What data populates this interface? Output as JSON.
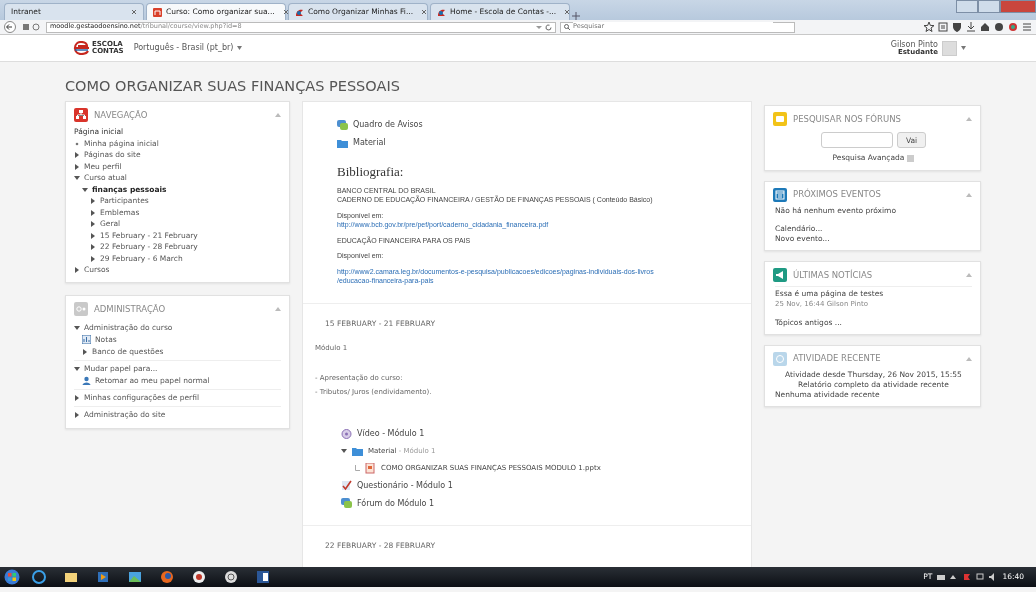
{
  "browser": {
    "tabs": [
      {
        "label": "Intranet",
        "selected": false,
        "kind": "plain"
      },
      {
        "label": "Curso: Como organizar sua...",
        "selected": true,
        "kind": "moodle"
      },
      {
        "label": "Como Organizar Minhas Fi...",
        "selected": false,
        "kind": "site"
      },
      {
        "label": "Home - Escola de Contas -...",
        "selected": false,
        "kind": "site"
      }
    ],
    "url_host": "moodle.gestaodoensino.net",
    "url_path": "/tribunal/course/view.php?id=8",
    "search_placeholder": "Pesquisar"
  },
  "header": {
    "logo_lines": [
      "ESCOLA",
      "CONTAS"
    ],
    "language": "Português - Brasil (pt_br)",
    "user_name": "Gilson Pinto",
    "user_role": "Estudante"
  },
  "course_title": "COMO ORGANIZAR SUAS FINANÇAS PESSOAIS",
  "left_blocks": [
    {
      "kind": "navigation",
      "title": "NAVEGAÇÃO",
      "tree": [
        {
          "label": "Página inicial",
          "kind": "link",
          "children": [
            {
              "label": "Minha página inicial",
              "kind": "leaf"
            },
            {
              "label": "Páginas do site",
              "kind": "branch",
              "expanded": false
            },
            {
              "label": "Meu perfil",
              "kind": "branch",
              "expanded": false
            },
            {
              "label": "Curso atual",
              "kind": "branch",
              "expanded": true,
              "children": [
                {
                  "label": "finanças pessoais",
                  "kind": "course",
                  "expanded": true,
                  "children": [
                    {
                      "label": "Participantes",
                      "kind": "branch",
                      "expanded": false
                    },
                    {
                      "label": "Emblemas",
                      "kind": "branch",
                      "expanded": false
                    },
                    {
                      "label": "Geral",
                      "kind": "branch",
                      "expanded": false
                    },
                    {
                      "label": "15 February - 21 February",
                      "kind": "branch",
                      "expanded": false
                    },
                    {
                      "label": "22 February - 28 February",
                      "kind": "branch",
                      "expanded": false
                    },
                    {
                      "label": "29 February - 6 March",
                      "kind": "branch",
                      "expanded": false
                    }
                  ]
                }
              ]
            },
            {
              "label": "Cursos",
              "kind": "branch",
              "expanded": false
            }
          ]
        }
      ]
    },
    {
      "kind": "settings",
      "title": "ADMINISTRAÇÃO",
      "groups": [
        {
          "label": "Administração do curso",
          "kind": "branch",
          "expanded": true,
          "children": [
            {
              "label": "Notas",
              "kind": "grades"
            },
            {
              "label": "Banco de questões",
              "kind": "branch",
              "expanded": false
            }
          ]
        },
        {
          "label": "Mudar papel para...",
          "kind": "branch",
          "expanded": true,
          "children": [
            {
              "label": "Retomar ao meu papel normal",
              "kind": "role"
            }
          ]
        },
        {
          "label": "Minhas configurações de perfil",
          "kind": "branch",
          "expanded": false
        },
        {
          "label": "Administração do site",
          "kind": "branch",
          "expanded": false
        }
      ]
    }
  ],
  "sections": [
    {
      "activities": [
        {
          "label": "Quadro de Avisos",
          "kind": "forum"
        },
        {
          "label": "Material",
          "kind": "folder"
        }
      ],
      "heading": "Bibliografia:",
      "paragraphs": [
        {
          "kind": "text",
          "lines": [
            "BANCO CENTRAL DO BRASIL",
            "CADERNO DE EDUCAÇÃO FINANCEIRA / GESTÃO DE FINANÇAS PESSOAIS ( Conteúdo Básico)"
          ]
        },
        {
          "kind": "source",
          "lines": [
            "Disponível em:",
            "http://www.bcb.gov.br/pre/pef/port/caderno_cidadania_financeira.pdf"
          ]
        },
        {
          "kind": "text",
          "lines": [
            "EDUCAÇÃO FINANCEIRA PARA OS PAIS"
          ]
        },
        {
          "kind": "text",
          "lines": [
            "Disponível em:"
          ]
        },
        {
          "kind": "link",
          "lines": [
            "http://www2.camara.leg.br/documentos-e-pesquisa/publicacoes/edicoes/paginas-individuais-dos-livros",
            "/educacao-financeira-para-pais"
          ]
        }
      ]
    },
    {
      "title": "15 FEBRUARY - 21 FEBRUARY",
      "summary": [
        "Módulo 1",
        "- Apresentação do curso:",
        "- Tributos/ Juros (endividamento)."
      ],
      "activities": [
        {
          "label": "Vídeo - Módulo 1",
          "kind": "video"
        },
        {
          "label": "Material",
          "suffix": " - Módulo 1",
          "kind": "folder_inline",
          "expanded": true,
          "children": [
            {
              "label": "COMO ORGANIZAR SUAS FINANÇAS PESSOAIS MODULO 1.pptx",
              "kind": "file"
            }
          ]
        },
        {
          "label": "Questionário - Módulo 1",
          "kind": "quiz"
        },
        {
          "label": "Fórum do Módulo 1",
          "kind": "forum"
        }
      ]
    },
    {
      "title": "22 FEBRUARY - 28 FEBRUARY"
    }
  ],
  "right_blocks": [
    {
      "kind": "search_forums",
      "title": "PESQUISAR NOS FÓRUNS",
      "button": "Vai",
      "link": "Pesquisa Avançada"
    },
    {
      "kind": "calendar",
      "title": "PRÓXIMOS EVENTOS",
      "lines": [
        "Não há nenhum evento próximo"
      ],
      "links": [
        "Calendário...",
        "Novo evento..."
      ]
    },
    {
      "kind": "news",
      "title": "ÚLTIMAS NOTÍCIAS",
      "posts": [
        {
          "title": "Essa é uma página de testes",
          "meta": "25 Nov, 16:44  Gilson Pinto"
        }
      ],
      "links": [
        "Tópicos antigos ..."
      ]
    },
    {
      "kind": "activity",
      "title": "ATIVIDADE RECENTE",
      "centered": [
        "Atividade desde Thursday, 26 Nov 2015, 15:55",
        "Relatório completo da atividade recente"
      ],
      "lines": [
        "Nenhuma atividade recente"
      ]
    }
  ],
  "taskbar": {
    "language": "PT",
    "time": "16:40"
  }
}
